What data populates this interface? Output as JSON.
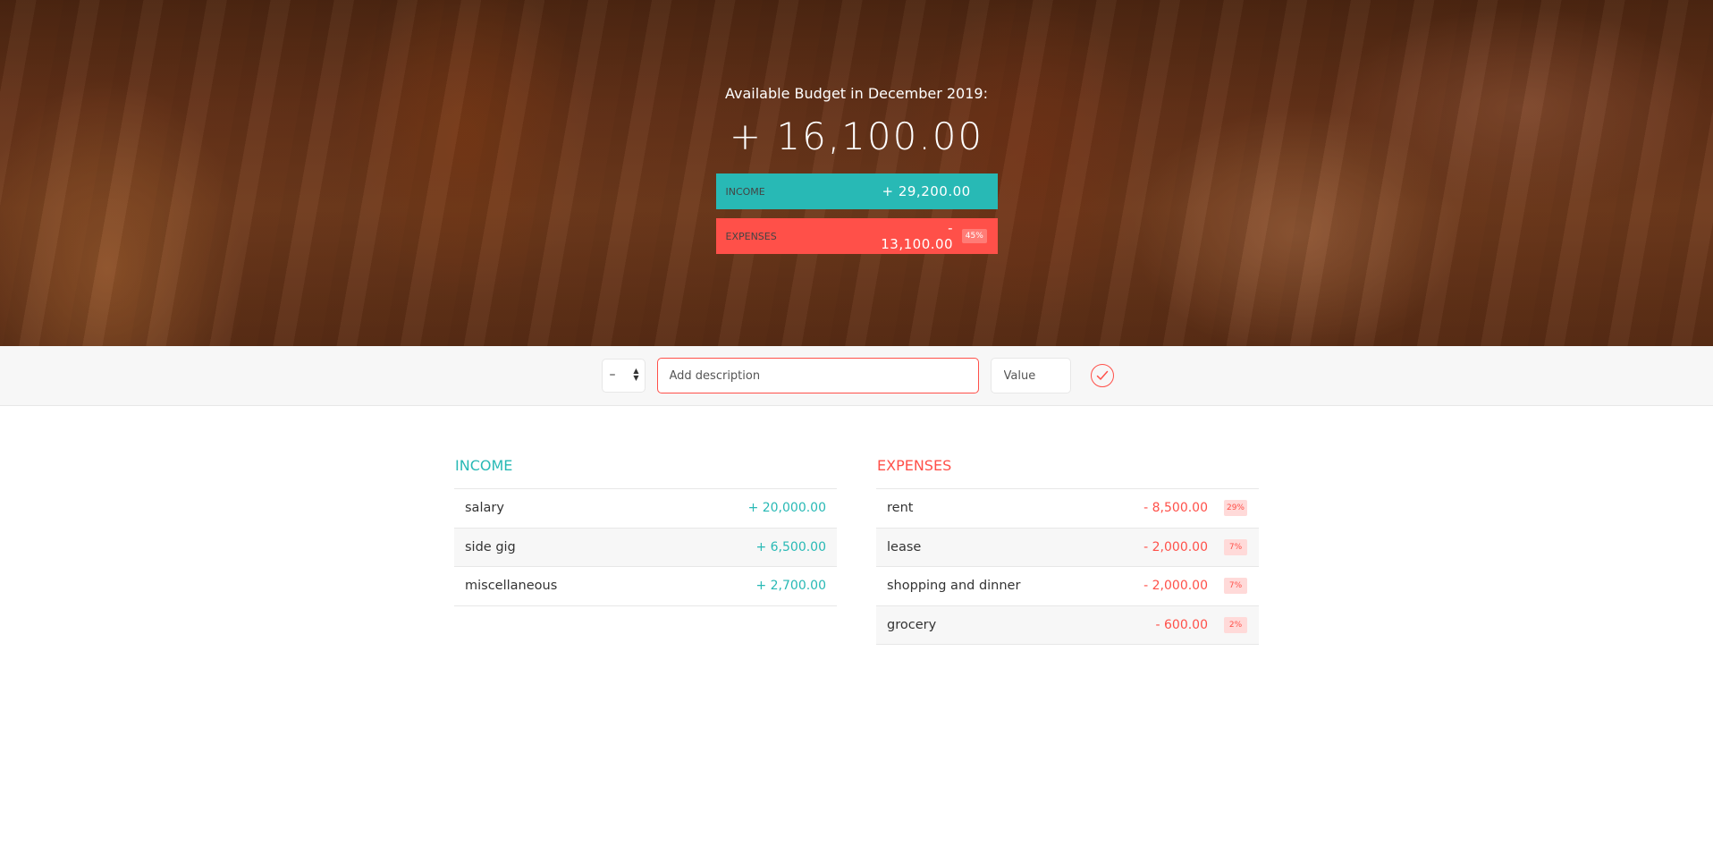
{
  "budget": {
    "title": "Available Budget in December 2019:",
    "value": "+ 16,100.00",
    "income": {
      "label": "Income",
      "value": "+ 29,200.00"
    },
    "expenses": {
      "label": "Expenses",
      "value": "- 13,100.00",
      "percentage": "45%"
    }
  },
  "add": {
    "type_value": "–",
    "type_arrows": "▲▼",
    "description_placeholder": "Add description",
    "value_placeholder": "Value",
    "button_icon": "checkmark-circle-icon"
  },
  "income": {
    "title": "Income",
    "items": [
      {
        "description": "salary",
        "value": "+ 20,000.00"
      },
      {
        "description": "side gig",
        "value": "+ 6,500.00"
      },
      {
        "description": "miscellaneous",
        "value": "+ 2,700.00"
      }
    ]
  },
  "expenses": {
    "title": "Expenses",
    "items": [
      {
        "description": "rent",
        "value": "- 8,500.00",
        "percentage": "29%"
      },
      {
        "description": "lease",
        "value": "- 2,000.00",
        "percentage": "7%"
      },
      {
        "description": "shopping and dinner",
        "value": "- 2,000.00",
        "percentage": "7%"
      },
      {
        "description": "grocery",
        "value": "- 600.00",
        "percentage": "2%"
      }
    ]
  },
  "colors": {
    "income": "#28b9b5",
    "expenses": "#ff5049",
    "percentage_bg": "#ffdad9"
  }
}
